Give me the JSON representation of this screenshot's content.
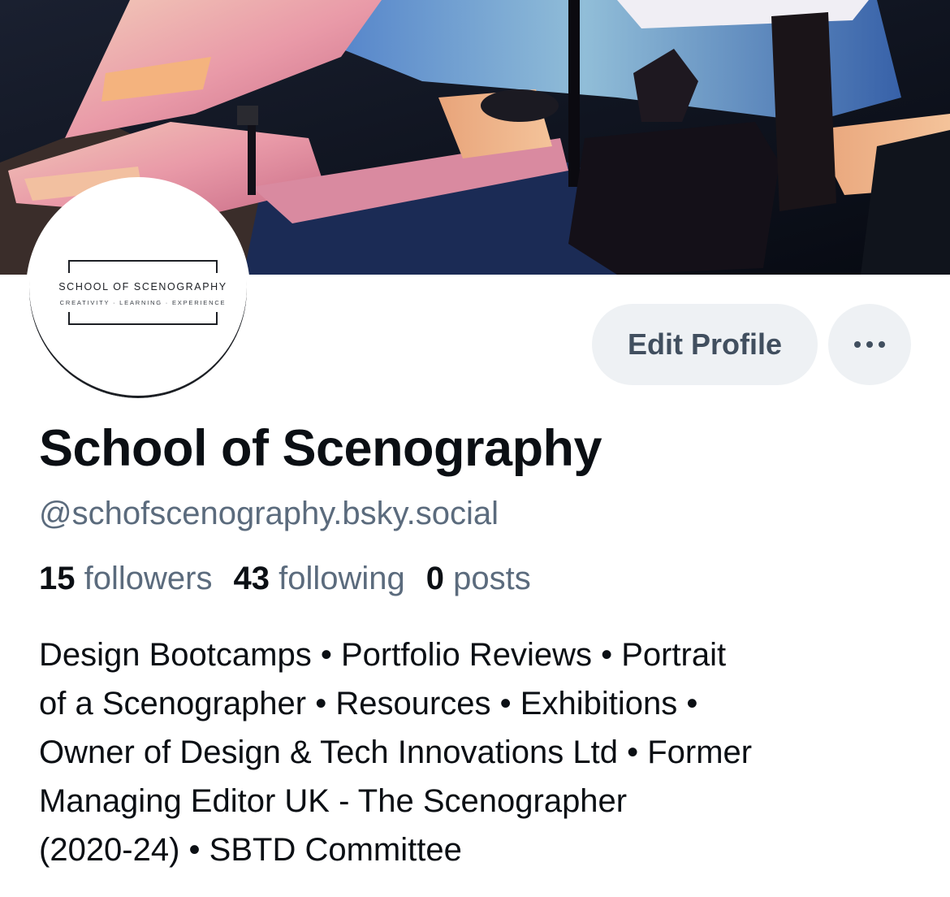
{
  "banner": {
    "image_description_icon": "scenography-set-banner-image"
  },
  "avatar": {
    "logo_title": "SCHOOL OF SCENOGRAPHY",
    "logo_subtitle": "CREATIVITY · LEARNING · EXPERIENCE"
  },
  "actions": {
    "edit_profile_label": "Edit Profile",
    "more_icon": "ellipsis-icon"
  },
  "profile": {
    "display_name": "School of Scenography",
    "handle": "@schofscenography.bsky.social"
  },
  "stats": {
    "followers_count": "15",
    "followers_label": "followers",
    "following_count": "43",
    "following_label": "following",
    "posts_count": "0",
    "posts_label": "posts"
  },
  "bio": {
    "lines": [
      "Design Bootcamps • Portfolio Reviews • Portrait",
      "of a Scenographer • Resources • Exhibitions •",
      "Owner of Design & Tech Innovations Ltd • Former",
      "Managing Editor UK - The Scenographer",
      "(2020-24) • SBTD Committee"
    ]
  },
  "colors": {
    "text_primary": "#0b0f14",
    "text_secondary": "#5b6b7d",
    "button_bg": "#eef1f4",
    "button_text": "#414f5f"
  }
}
